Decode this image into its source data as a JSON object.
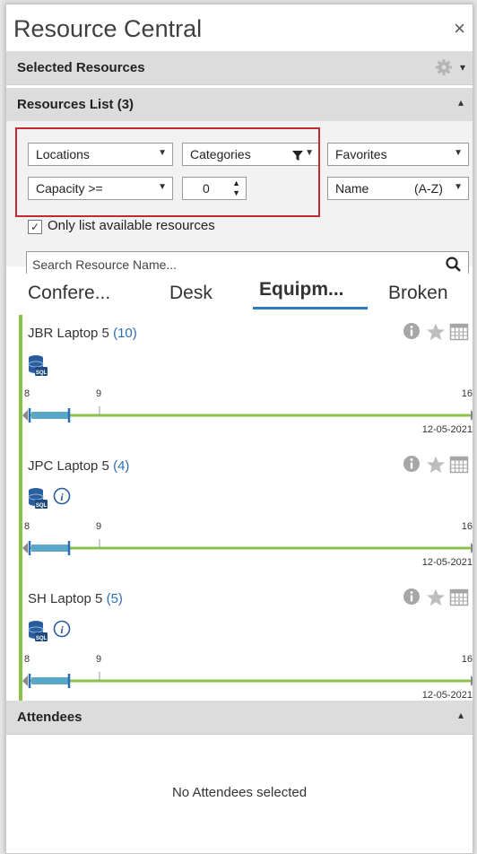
{
  "title": "Resource Central",
  "close_glyph": "×",
  "sections": {
    "selected": "Selected Resources",
    "list": "Resources List (3)",
    "attendees": "Attendees"
  },
  "filters": {
    "locations": "Locations",
    "categories": "Categories",
    "favorites": "Favorites",
    "capacity": "Capacity >=",
    "capacity_value": "0",
    "sort_name": "Name",
    "sort_order": "(A-Z)",
    "only_available": "Only list available resources",
    "only_available_checked": true,
    "search_placeholder": "Search Resource Name..."
  },
  "tabs": [
    {
      "label": "Confere...",
      "active": false
    },
    {
      "label": "Desk",
      "active": false
    },
    {
      "label": "Equipm...",
      "active": true
    },
    {
      "label": "Broken",
      "active": false
    }
  ],
  "resources": [
    {
      "name": "JBR Laptop 5",
      "count": "(10)",
      "has_info": false,
      "start": "8",
      "mid": "9",
      "end": "16",
      "date": "12-05-2021"
    },
    {
      "name": "JPC Laptop 5",
      "count": "(4)",
      "has_info": true,
      "start": "8",
      "mid": "9",
      "end": "16",
      "date": "12-05-2021"
    },
    {
      "name": "SH Laptop 5",
      "count": "(5)",
      "has_info": true,
      "start": "8",
      "mid": "9",
      "end": "16",
      "date": "12-05-2021"
    }
  ],
  "attendees_empty": "No Attendees selected",
  "colors": {
    "accent": "#2b7bc0",
    "timeline": "#8bc34a",
    "booked": "#5aa7c9",
    "highlight": "#c22a32"
  }
}
